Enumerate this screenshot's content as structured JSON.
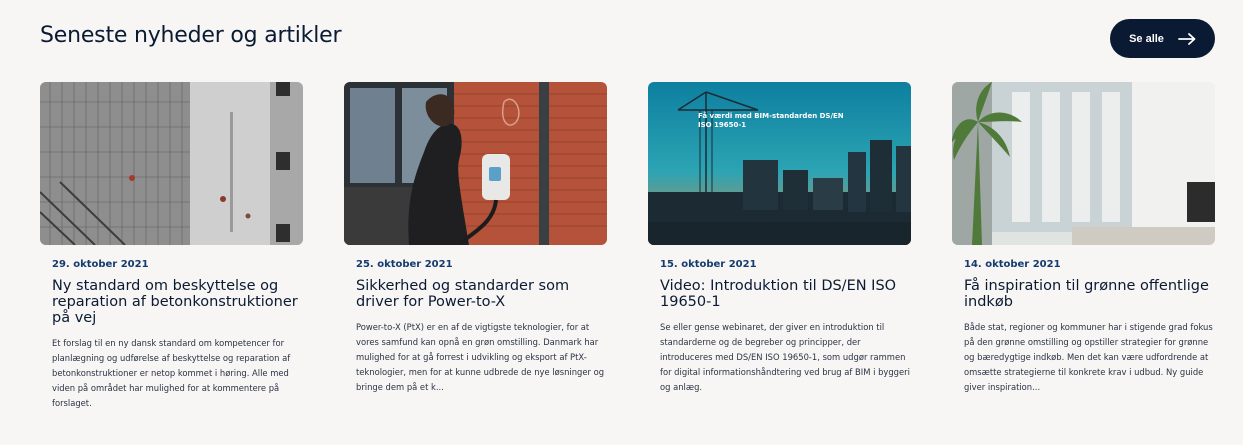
{
  "section": {
    "title": "Seneste nyheder og artikler",
    "see_all_label": "Se alle",
    "see_all_icon": "arrow-right-icon"
  },
  "articles": [
    {
      "date": "29. oktober 2021",
      "title": "Ny standard om beskyttelse og reparation af betonkonstruktioner på vej",
      "excerpt": "Et forslag til en ny dansk standard om kompetencer for planlægning og udførelse af beskyttelse og reparation af betonkonstruktioner er netop kommet i høring. Alle med viden på området har mulighed for at kommentere på forslaget."
    },
    {
      "date": "25. oktober 2021",
      "title": "Sikkerhed og standarder som driver for Power-to-X",
      "excerpt": "Power-to-X (PtX) er en af de vigtigste teknologier, for at vores samfund kan opnå en grøn omstilling. Danmark har mulighed for at gå forrest i udvikling og eksport af PtX-teknologier, men for at kunne udbrede de nye løsninger og bringe dem på et k..."
    },
    {
      "date": "15. oktober 2021",
      "title": "Video: Introduktion til DS/EN ISO 19650-1",
      "excerpt": "Se eller gense webinaret, der giver en introduktion til standarderne og de begreber og principper, der introduceres med DS/EN ISO 19650-1, som udgør rammen for digital informationshåndtering ved brug af BIM i byggeri og anlæg.",
      "image_text": "Få værdi med BIM-standarden DS/EN ISO 19650-1"
    },
    {
      "date": "14. oktober 2021",
      "title": "Få inspiration til grønne offentlige indkøb",
      "excerpt": "Både stat, regioner og kommuner har i stigende grad fokus på den grønne omstilling og opstiller strategier for grønne og bæredygtige indkøb. Men det kan være udfordrende at omsætte strategierne til konkrete krav i udbud. Ny guide giver inspiration..."
    }
  ],
  "colors": {
    "navy": "#0b1a33",
    "date_blue": "#153b6f",
    "panel_bg": "#f7f6f4"
  }
}
